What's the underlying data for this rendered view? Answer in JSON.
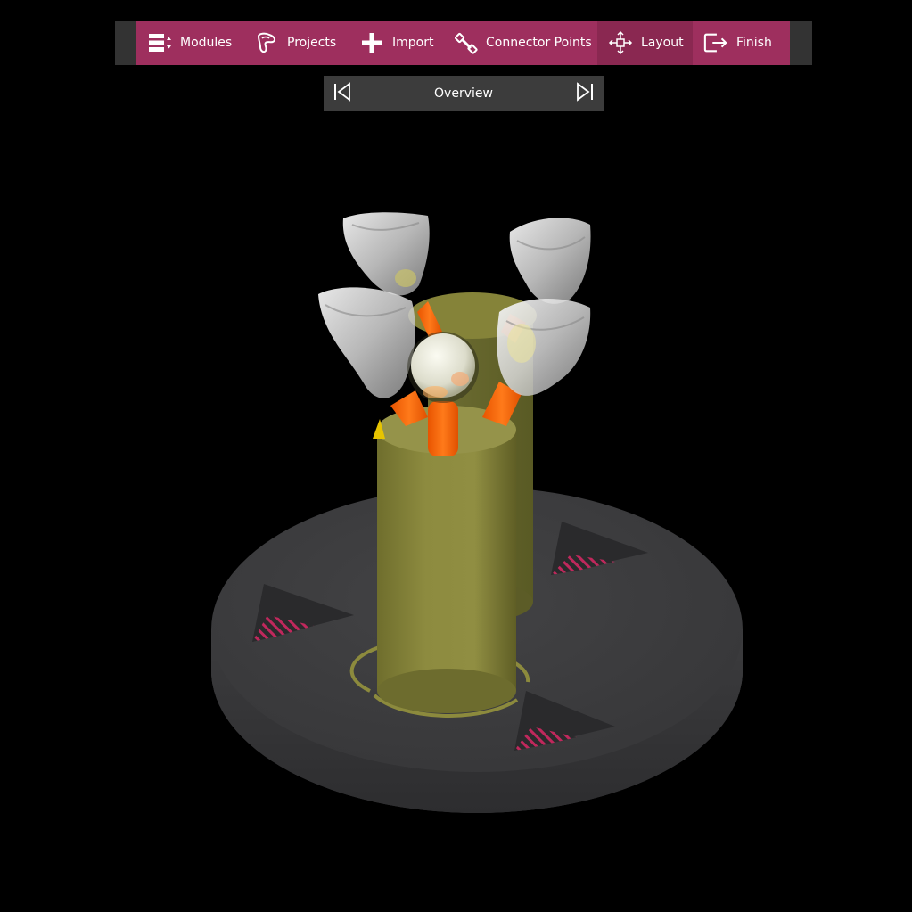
{
  "toolbar": {
    "items": [
      {
        "label": "Modules",
        "icon": "modules-icon"
      },
      {
        "label": "Projects",
        "icon": "projects-icon"
      },
      {
        "label": "Import",
        "icon": "plus-icon"
      },
      {
        "label": "Connector Points",
        "icon": "connector-points-icon"
      },
      {
        "label": "Layout",
        "icon": "move-arrows-icon"
      },
      {
        "label": "Finish",
        "icon": "exit-icon"
      }
    ],
    "active": "Layout"
  },
  "nav": {
    "title": "Overview",
    "prev_icon": "skip-previous-icon",
    "next_icon": "skip-next-icon"
  },
  "colors": {
    "toolbar_bg": "#9e2f5e",
    "toolbar_active": "#8a2851",
    "toolbar_frame": "#333333",
    "nav_bg": "#3c3c3c",
    "viewport_bg": "#000000",
    "model_olive": "#8c8a3d",
    "support_orange": "#ff6a10",
    "base_dark": "#3d3d3f",
    "marker_pink": "#c0285c"
  }
}
